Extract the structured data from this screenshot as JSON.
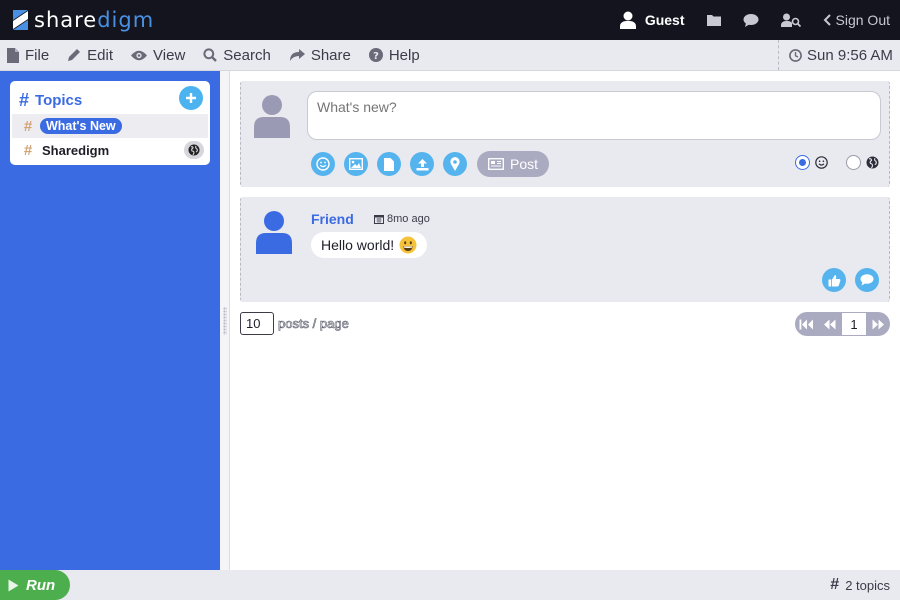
{
  "app": {
    "logo_part1": "share",
    "logo_part2": "digm"
  },
  "header": {
    "user_label": "Guest",
    "signout_label": "Sign Out"
  },
  "menu": {
    "file": "File",
    "edit": "Edit",
    "view": "View",
    "search": "Search",
    "share": "Share",
    "help": "Help",
    "clock": "Sun 9:56 AM"
  },
  "sidebar": {
    "title": "Topics",
    "items": [
      {
        "label": "What's New",
        "selected": true
      },
      {
        "label": "Sharedigm",
        "selected": false
      }
    ]
  },
  "composer": {
    "placeholder": "What's new?",
    "post_label": "Post"
  },
  "feed": {
    "posts": [
      {
        "author": "Friend",
        "time_ago": "8mo ago",
        "message": "Hello world!"
      }
    ]
  },
  "pagination": {
    "per_page_value": "10",
    "per_page_label": "posts / page",
    "current_page": "1"
  },
  "statusbar": {
    "run_label": "Run",
    "topic_count": "2 topics"
  },
  "colors": {
    "accent": "#3b6be3",
    "button": "#55b4ee",
    "run": "#4cae4c"
  }
}
